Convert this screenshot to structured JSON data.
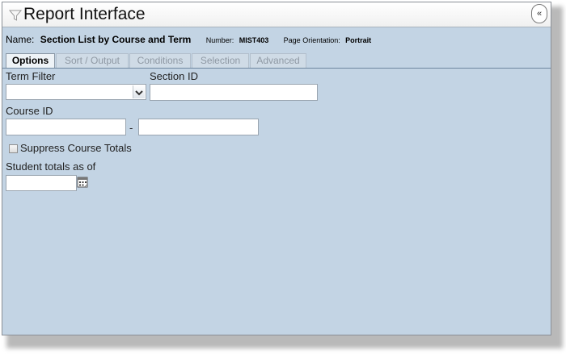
{
  "window": {
    "title": "Report Interface",
    "collapse_glyph": "«"
  },
  "report": {
    "name_label": "Name:",
    "name_value": "Section List by Course and Term",
    "number_label": "Number:",
    "number_value": "MIST403",
    "orientation_label": "Page Orientation:",
    "orientation_value": "Portrait"
  },
  "tabs": [
    {
      "label": "Options",
      "active": true
    },
    {
      "label": "Sort / Output",
      "active": false
    },
    {
      "label": "Conditions",
      "active": false
    },
    {
      "label": "Selection",
      "active": false
    },
    {
      "label": "Advanced",
      "active": false
    }
  ],
  "form": {
    "term_filter_label": "Term Filter",
    "term_filter_value": "",
    "section_id_label": "Section ID",
    "section_id_value": "",
    "course_id_label": "Course ID",
    "course_id_from": "",
    "course_id_separator": "-",
    "course_id_to": "",
    "suppress_totals_label": "Suppress Course Totals",
    "suppress_totals_checked": false,
    "student_totals_label": "Student totals as of",
    "student_totals_value": ""
  },
  "icons": {
    "title": "funnel-icon",
    "collapse": "double-chevron-left-icon",
    "dropdown": "chevron-down-icon",
    "date_picker": "calendar-icon"
  },
  "colors": {
    "panel_background": "#c3d4e4",
    "title_bar": "#f4f4f4",
    "tab_active": "#eef3f7",
    "tab_inactive_text": "#8f99a4",
    "border": "#8a8f96"
  }
}
